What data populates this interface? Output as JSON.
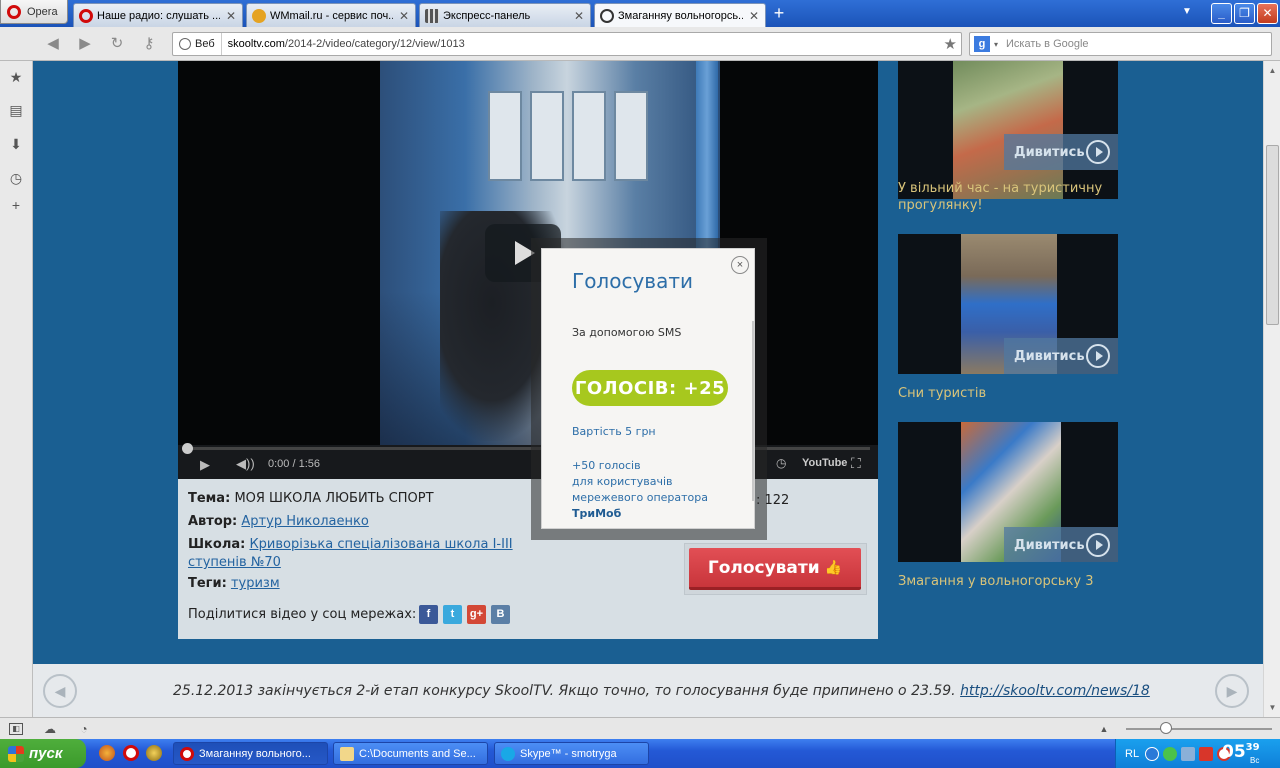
{
  "browser": {
    "menu_label": "Opera",
    "tabs": [
      {
        "label": "Наше радио: слушать ...",
        "icon": "opera-icon",
        "active": false
      },
      {
        "label": "WMmail.ru - сервис поч...",
        "icon": "wmmail-icon",
        "active": false
      },
      {
        "label": "Экспресс-панель",
        "icon": "speed-dial-icon",
        "active": false
      },
      {
        "label": "Змаганняу вольногорсь...",
        "icon": "skooltv-icon",
        "active": true
      }
    ],
    "address": {
      "site_button": "Веб",
      "url_domain": "skooltv.com",
      "url_path": "/2014-2/video/category/12/view/1013"
    },
    "search": {
      "engine": "g",
      "placeholder": "Искать в Google"
    }
  },
  "video": {
    "time": "0:00 / 1:56",
    "youtube_label": "YouTube",
    "progress_fraction": 0.0
  },
  "info": {
    "topic_label": "Тема:",
    "topic_value": "МОЯ ШКОЛА ЛЮБИТЬ СПОРТ",
    "author_label": "Автор:",
    "author_value": "Артур Николаенко",
    "school_label": "Школа:",
    "school_value_1": "Криворізька спеціалізована школа I-III",
    "school_value_2": "ступенів №70",
    "tags_label": "Теги:",
    "tags_value": "туризм",
    "views_value": ": 122",
    "vote_button": "Голосувати",
    "share_label": "Поділитися відео у соц мережах:"
  },
  "social": [
    {
      "name": "facebook-icon",
      "glyph": "f",
      "color": "#3b5998"
    },
    {
      "name": "twitter-icon",
      "glyph": "t",
      "color": "#3aa9dd"
    },
    {
      "name": "google-plus-icon",
      "glyph": "g+",
      "color": "#d34836"
    },
    {
      "name": "vk-icon",
      "glyph": "B",
      "color": "#5b7fa6"
    }
  ],
  "sidebar_videos": [
    {
      "watch": "Дивитись",
      "title": "У вільний час - на туристичну прогулянку!"
    },
    {
      "watch": "Дивитись",
      "title": "Сни туристів"
    },
    {
      "watch": "Дивитись",
      "title": "Змагання у вольногорську 3"
    }
  ],
  "banner": {
    "text": "25.12.2013 закінчується 2-й етап конкурсу SkoolTV. Якщо точно, то голосування буде припинено о 23.59.",
    "link": "http://skooltv.com/news/18"
  },
  "modal": {
    "title": "Голосувати",
    "subtitle": "За допомогою SMS",
    "pill": "ГОЛОСІВ: +25",
    "price": "Вартість 5 грн",
    "bonus_1": "+50 голосів",
    "bonus_2": "для користувачів",
    "bonus_3": "мережевого оператора",
    "operator": "ТриМоб",
    "close_glyph": "×"
  },
  "taskbar": {
    "start": "пуск",
    "tasks": [
      {
        "label": "Змаганняу вольного...",
        "icon": "opera-icon",
        "active": true
      },
      {
        "label": "C:\\Documents and Se...",
        "icon": "folder-icon",
        "active": false
      },
      {
        "label": "Skype™ - smotryga",
        "icon": "skype-icon",
        "active": false
      }
    ],
    "lang": "RL",
    "clock_hour": "05",
    "clock_min": "39",
    "clock_day": "Вс"
  }
}
